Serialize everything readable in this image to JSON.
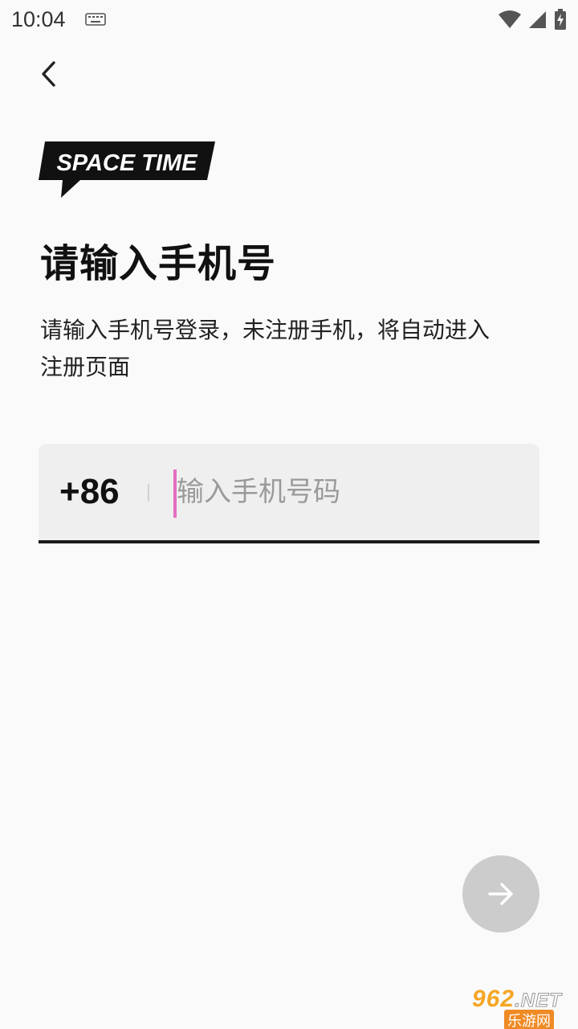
{
  "status_bar": {
    "time": "10:04",
    "icons": [
      "keyboard-icon",
      "wifi-icon",
      "signal-icon",
      "battery-charging-icon"
    ]
  },
  "nav": {
    "back_icon": "chevron-left-icon"
  },
  "logo": {
    "text": "SPACE TIME"
  },
  "title": "请输入手机号",
  "description": "请输入手机号登录，未注册手机，将自动进入注册页面",
  "phone_form": {
    "country_code": "+86",
    "value": "",
    "placeholder": "输入手机号码"
  },
  "next_button": {
    "icon": "arrow-right-icon"
  },
  "watermark": {
    "top": "962.NET",
    "brand": "962",
    "suffix": ".NET",
    "bottom": "乐游网"
  },
  "colors": {
    "cursor": "#e46ec0",
    "next_button_bg": "#cccccc",
    "underline": "#1a1a1a"
  }
}
